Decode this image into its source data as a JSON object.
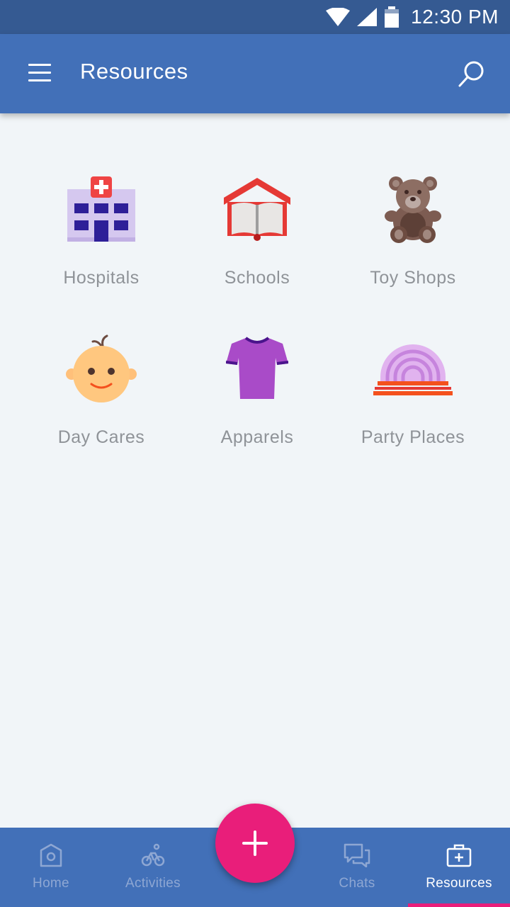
{
  "status_bar": {
    "time": "12:30 PM",
    "icons": [
      "wifi-icon",
      "signal-icon",
      "battery-icon"
    ]
  },
  "app_bar": {
    "title": "Resources",
    "menu_icon": "menu-icon",
    "search_icon": "search-icon"
  },
  "categories": [
    {
      "label": "Hospitals",
      "icon": "hospital-icon"
    },
    {
      "label": "Schools",
      "icon": "school-icon"
    },
    {
      "label": "Toy Shops",
      "icon": "teddy-bear-icon"
    },
    {
      "label": "Day Cares",
      "icon": "baby-icon"
    },
    {
      "label": "Apparels",
      "icon": "tshirt-icon"
    },
    {
      "label": "Party Places",
      "icon": "party-stage-icon"
    }
  ],
  "fab": {
    "icon": "plus-icon"
  },
  "bottom_nav": {
    "items": [
      {
        "label": "Home",
        "icon": "home-icon",
        "active": false
      },
      {
        "label": "Activities",
        "icon": "bicycle-icon",
        "active": false
      },
      {
        "label": "",
        "icon": "",
        "active": false
      },
      {
        "label": "Chats",
        "icon": "chat-icon",
        "active": false
      },
      {
        "label": "Resources",
        "icon": "medical-kit-icon",
        "active": true
      }
    ]
  },
  "colors": {
    "status_bar": "#355a92",
    "app_bar": "#4270b8",
    "background": "#f1f5f8",
    "accent": "#e91e7a",
    "label_gray": "#8f9398"
  }
}
